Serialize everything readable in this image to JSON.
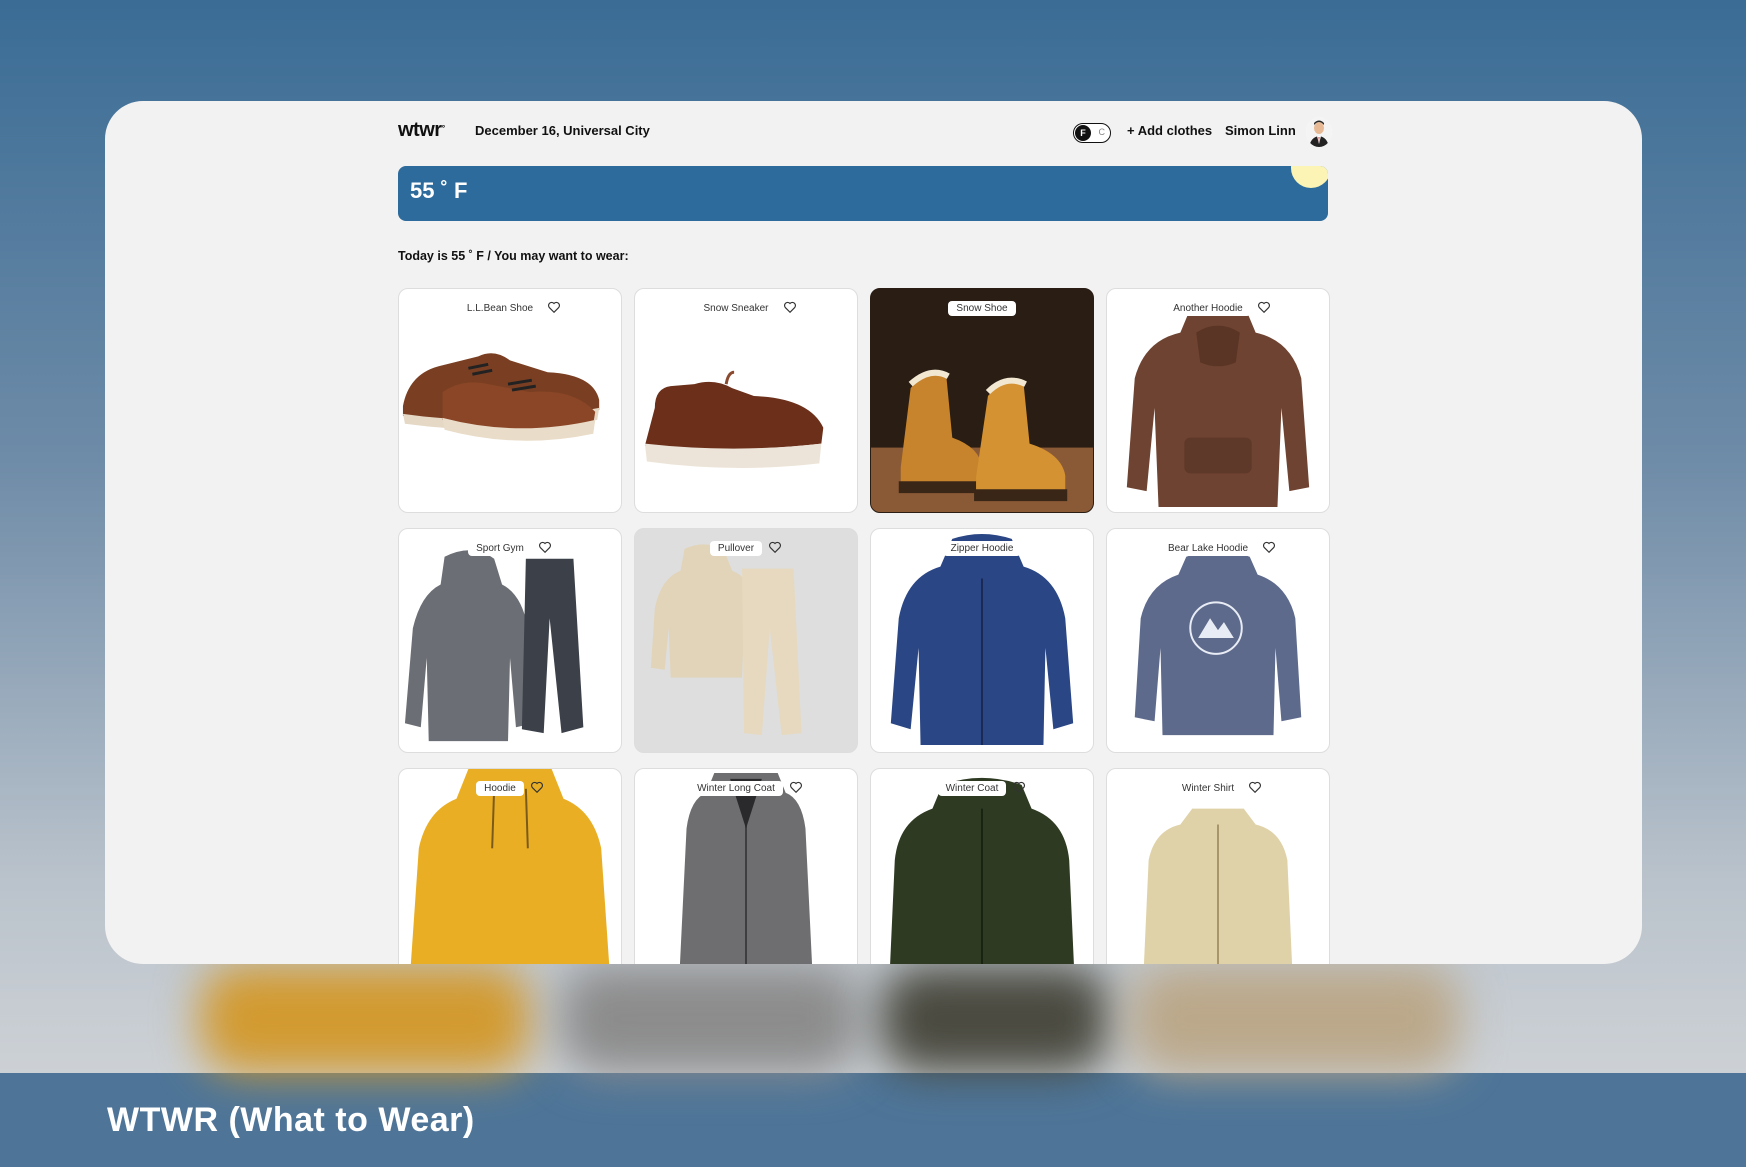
{
  "header": {
    "logo": "wtwr",
    "logo_mark": "°",
    "date_location": "December 16, Universal City",
    "toggle": {
      "active": "F",
      "inactive": "C"
    },
    "add_clothes": "+ Add clothes",
    "username": "Simon Linn"
  },
  "weather": {
    "temperature": "55 ˚ F"
  },
  "recommendation": "Today is 55 ˚ F / You may want to wear:",
  "items": [
    {
      "name": "L.L.Bean Shoe"
    },
    {
      "name": "Snow Sneaker"
    },
    {
      "name": "Snow Shoe"
    },
    {
      "name": "Another Hoodie"
    },
    {
      "name": "Sport Gym"
    },
    {
      "name": "Pullover"
    },
    {
      "name": "Zipper Hoodie"
    },
    {
      "name": "Bear Lake Hoodie"
    },
    {
      "name": "Hoodie"
    },
    {
      "name": "Winter Long Coat"
    },
    {
      "name": "Winter Coat"
    },
    {
      "name": "Winter Shirt"
    }
  ],
  "caption": "WTWR (What to Wear)",
  "colors": {
    "accent": "#2c6b9c",
    "sun": "#fbf4b5"
  }
}
